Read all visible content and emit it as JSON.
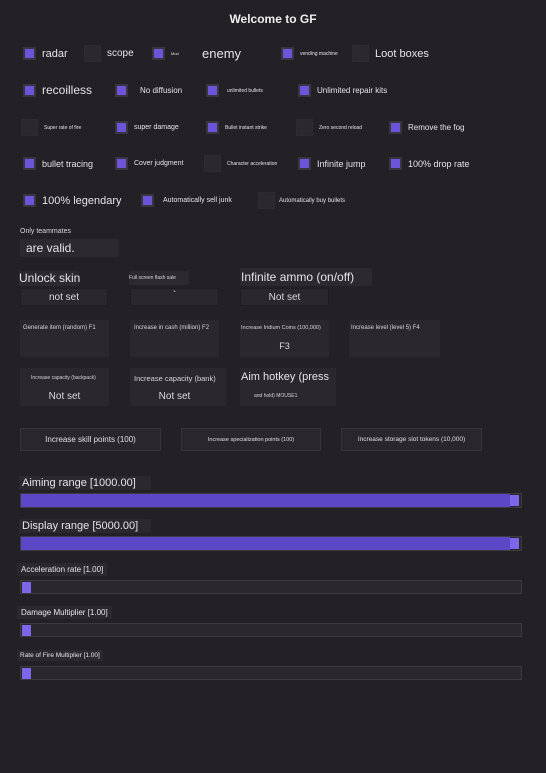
{
  "title": "Welcome to GF",
  "checkboxes": {
    "radar": {
      "label": "radar",
      "checked": true
    },
    "scope": {
      "label": "scope",
      "checked": false
    },
    "mod": {
      "label": "Mod",
      "checked": true
    },
    "enemy": {
      "label": "enemy"
    },
    "vending": {
      "label": "vending machine",
      "checked": true
    },
    "loot": {
      "label": "Loot boxes",
      "checked": false
    },
    "recoilless": {
      "label": "recoilless",
      "checked": true
    },
    "no_diffusion": {
      "label": "No diffusion",
      "checked": true
    },
    "unlimited_bullets": {
      "label": "unlimited bullets",
      "checked": true
    },
    "unlimited_repair": {
      "label": "Unlimited repair kits",
      "checked": true
    },
    "super_rate": {
      "label": "Super rate of fire",
      "checked": false
    },
    "super_damage": {
      "label": "super damage",
      "checked": true
    },
    "bullet_strike": {
      "label": "Bullet instant strike",
      "checked": true
    },
    "zero_reload": {
      "label": "Zero second reload",
      "checked": false
    },
    "remove_fog": {
      "label": "Remove the fog",
      "checked": true
    },
    "bullet_tracing": {
      "label": "bullet tracing",
      "checked": true
    },
    "cover_judgment": {
      "label": "Cover judgment",
      "checked": true
    },
    "char_accel": {
      "label": "Character acceleration",
      "checked": false
    },
    "infinite_jump": {
      "label": "Infinite jump",
      "checked": true
    },
    "drop_rate": {
      "label": "100% drop rate",
      "checked": true
    },
    "legendary": {
      "label": "100% legendary",
      "checked": true
    },
    "sell_junk": {
      "label": "Automatically sell junk",
      "checked": true
    },
    "buy_bullets": {
      "label": "Automatically buy bullets",
      "checked": false
    }
  },
  "teammates": {
    "line1": "Only teammates",
    "line2": "are valid."
  },
  "unlock_skin": {
    "label": "Unlock skin",
    "value": "not set"
  },
  "fullscreen_flash": {
    "label": "Full screen flash sale",
    "value": "`"
  },
  "infinite_ammo": {
    "label": "Infinite ammo (on/off)",
    "value": "Not set"
  },
  "generate_item": {
    "label": "Generate item (random) F1"
  },
  "increase_cash": {
    "label": "Increase in cash (million) F2"
  },
  "increase_iridium": {
    "label": "Increase Iridium Coins (100,000)",
    "value": "F3"
  },
  "increase_level": {
    "label": "Increase level (level 5) F4"
  },
  "capacity_backpack": {
    "label": "Increase capacity (backpack)",
    "value": "Not set"
  },
  "capacity_bank": {
    "label": "Increase capacity (bank)",
    "value": "Not set"
  },
  "aim_hotkey": {
    "label": "Aim hotkey (press",
    "value": "and hold) MOUSE1"
  },
  "buttons": {
    "skill_points": "Increase skill points (100)",
    "specialization": "Increase specialization points (100)",
    "storage_slot": "Increase storage slot tokens (10,000)"
  },
  "sliders": {
    "aiming": {
      "label": "Aiming range [1000.00]",
      "fraction": 1.0
    },
    "display": {
      "label": "Display range [5000.00]",
      "fraction": 1.0
    },
    "acceleration": {
      "label": "Acceleration rate [1.00]",
      "fraction": 0.0
    },
    "damage": {
      "label": "Damage Multiplier [1.00]",
      "fraction": 0.0
    },
    "fire_rate": {
      "label": "Rate of Fire Multiplier [1.00]",
      "fraction": 0.0
    }
  },
  "colors": {
    "accent": "#6e54d8",
    "fill": "#5c47c6",
    "background": "#232125"
  }
}
